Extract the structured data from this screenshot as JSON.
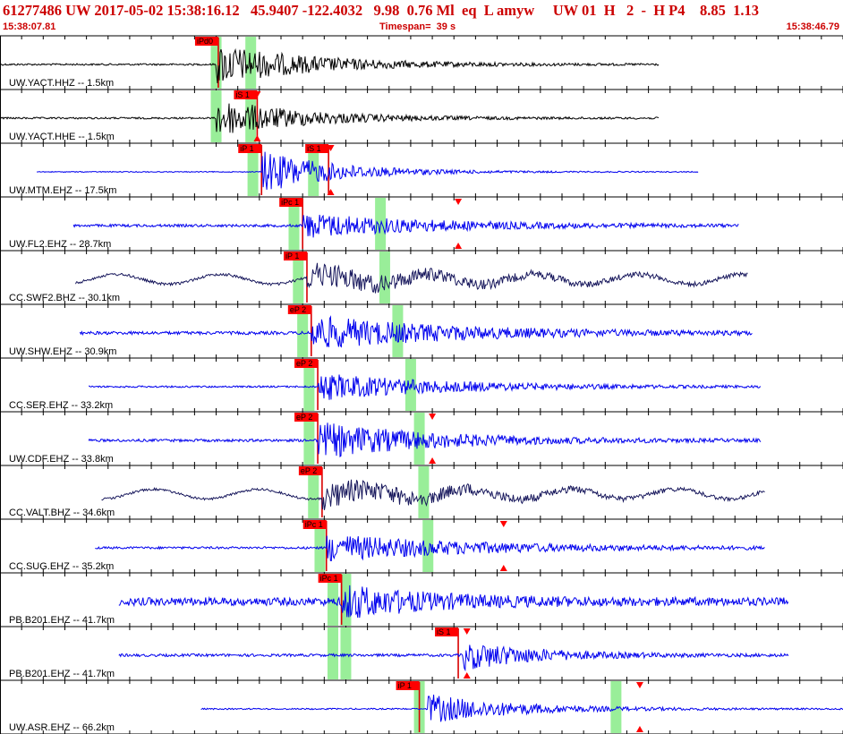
{
  "header": {
    "title": "61277486 UW 2017-05-02 15:38:16.12   45.9407 -122.4032   9.98  0.76 Ml  eq  L amyw     UW 01  H   2  -  H P4    8.85  1.13",
    "start_time": "15:38:07.81",
    "timespan": "Timespan=  39 s",
    "end_time": "15:38:46.79"
  },
  "colors": {
    "header_text": "#cc0000",
    "trace_black": "#000000",
    "trace_blue": "#0000ee",
    "trace_navy": "#1a1a5e",
    "pick_bar": "#d80000",
    "pick_flag": "#ff0000",
    "window": "#99ee99",
    "frame": "#000000"
  },
  "chart_data": {
    "type": "line",
    "x_unit": "seconds after 15:38:07.81",
    "x_range": [
      0,
      39
    ],
    "tick_spacing_s": 1,
    "traces": [
      {
        "label": "UW.YACT.HHZ -- 1.5km",
        "color": "black",
        "start": 0.0,
        "end": 30.5,
        "noise": 0.04,
        "onset": 10.0,
        "peak": 0.9,
        "decay": 4.5,
        "picks": [
          {
            "label": "iPd0",
            "t": 10.1
          }
        ],
        "windows": [
          10.0,
          11.6
        ],
        "markers": []
      },
      {
        "label": "UW.YACT.HHE -- 1.5km",
        "color": "black",
        "start": 0.0,
        "end": 30.5,
        "noise": 0.04,
        "onset": 10.0,
        "peak": 0.85,
        "decay": 4.0,
        "picks": [
          {
            "label": "iS 1",
            "t": 11.9
          }
        ],
        "windows": [
          10.0,
          11.6
        ],
        "markers": [
          11.9
        ]
      },
      {
        "label": "UW.MTM.EHZ -- 17.5km",
        "color": "blue",
        "start": 1.7,
        "end": 32.3,
        "noise": 0.02,
        "onset": 12.1,
        "peak": 0.95,
        "decay": 3.5,
        "picks": [
          {
            "label": "iP 1",
            "t": 12.1
          },
          {
            "label": "iS 1",
            "t": 15.2
          }
        ],
        "windows": [
          11.7,
          14.5
        ],
        "markers": [
          15.3
        ]
      },
      {
        "label": "UW.FL2.EHZ -- 28.7km",
        "color": "blue",
        "start": 3.4,
        "end": 34.2,
        "noise": 0.06,
        "onset": 14.0,
        "peak": 0.55,
        "decay": 6.0,
        "picks": [
          {
            "label": "iPc 1",
            "t": 14.0
          }
        ],
        "windows": [
          13.6,
          17.6
        ],
        "markers": [
          21.2
        ]
      },
      {
        "label": "CC.SWF2.BHZ -- 30.1km",
        "color": "navy",
        "start": 3.5,
        "end": 34.6,
        "noise": 0.06,
        "onset": 14.2,
        "peak": 0.55,
        "decay": 7.0,
        "picks": [
          {
            "label": "iP 1",
            "t": 14.2
          }
        ],
        "windows": [
          13.8,
          17.8
        ],
        "markers": []
      },
      {
        "label": "UW.SHW.EHZ -- 30.9km",
        "color": "blue",
        "start": 3.7,
        "end": 34.8,
        "noise": 0.07,
        "onset": 14.4,
        "peak": 0.75,
        "decay": 6.5,
        "picks": [
          {
            "label": "eP 2",
            "t": 14.4
          }
        ],
        "windows": [
          14.0,
          18.4
        ],
        "markers": []
      },
      {
        "label": "CC.SER.EHZ -- 33.2km",
        "color": "blue",
        "start": 4.1,
        "end": 35.2,
        "noise": 0.04,
        "onset": 14.7,
        "peak": 0.6,
        "decay": 6.0,
        "picks": [
          {
            "label": "eP 2",
            "t": 14.7
          }
        ],
        "windows": [
          14.3,
          19.0
        ],
        "markers": []
      },
      {
        "label": "UW.CDF.EHZ -- 33.8km",
        "color": "blue",
        "start": 4.1,
        "end": 35.2,
        "noise": 0.06,
        "onset": 14.7,
        "peak": 0.8,
        "decay": 5.5,
        "picks": [
          {
            "label": "eP 2",
            "t": 14.7
          }
        ],
        "windows": [
          14.3,
          19.4
        ],
        "markers": [
          20.0
        ]
      },
      {
        "label": "CC.VALT.BHZ -- 34.6km",
        "color": "navy",
        "start": 4.7,
        "end": 35.4,
        "noise": 0.05,
        "onset": 14.9,
        "peak": 0.55,
        "decay": 7.0,
        "picks": [
          {
            "label": "eP 2",
            "t": 14.9
          }
        ],
        "windows": [
          14.5,
          19.6
        ],
        "markers": []
      },
      {
        "label": "CC.SUG.EHZ -- 35.2km",
        "color": "blue",
        "start": 4.4,
        "end": 35.4,
        "noise": 0.05,
        "onset": 15.1,
        "peak": 0.6,
        "decay": 7.0,
        "picks": [
          {
            "label": "iPc 1",
            "t": 15.1
          }
        ],
        "windows": [
          14.8,
          19.8
        ],
        "markers": [
          23.3
        ]
      },
      {
        "label": "PB.B201.EHZ -- 41.7km",
        "color": "blue",
        "start": 5.5,
        "end": 36.5,
        "noise": 0.18,
        "onset": 15.8,
        "peak": 0.7,
        "decay": 4.0,
        "picks": [
          {
            "label": "iPc 1",
            "t": 15.8
          }
        ],
        "windows": [
          15.4,
          16.0
        ],
        "markers": []
      },
      {
        "label": "PB.B201.EHZ -- 41.7km",
        "color": "blue",
        "start": 5.5,
        "end": 36.5,
        "noise": 0.06,
        "onset": 21.4,
        "peak": 0.65,
        "decay": 3.5,
        "picks": [
          {
            "label": "iS 1",
            "t": 21.2
          }
        ],
        "windows": [
          15.4,
          16.0
        ],
        "markers": [
          21.6
        ]
      },
      {
        "label": "UW.ASR.EHZ -- 66.2km",
        "color": "blue",
        "start": 9.3,
        "end": 40.0,
        "noise": 0.03,
        "onset": 19.8,
        "peak": 0.65,
        "decay": 4.0,
        "picks": [
          {
            "label": "iP 1",
            "t": 19.4
          }
        ],
        "windows": [
          19.4,
          28.5
        ],
        "markers": [
          29.6
        ]
      }
    ]
  }
}
